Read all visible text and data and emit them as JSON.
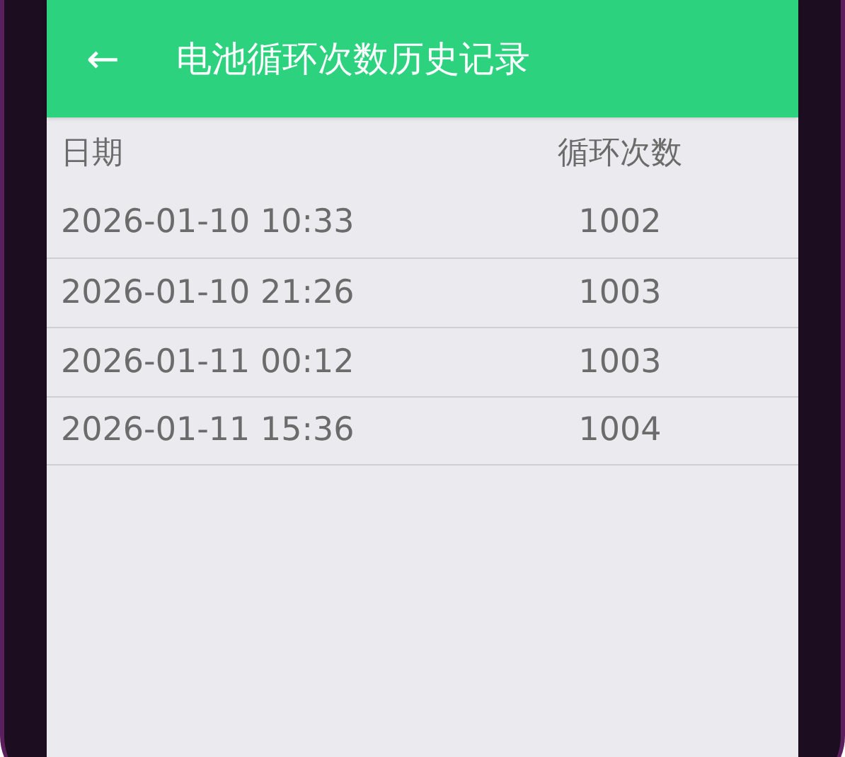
{
  "header": {
    "back": "←",
    "title": "电池循环次数历史记录"
  },
  "table": {
    "columns": [
      "日期",
      "循环次数"
    ],
    "rows": [
      [
        "2026-01-10 10:33",
        "1002"
      ],
      [
        "2026-01-10 21:26",
        "1003"
      ],
      [
        "2026-01-11 00:12",
        "1003"
      ],
      [
        "2026-01-11 15:36",
        "1004"
      ]
    ]
  }
}
